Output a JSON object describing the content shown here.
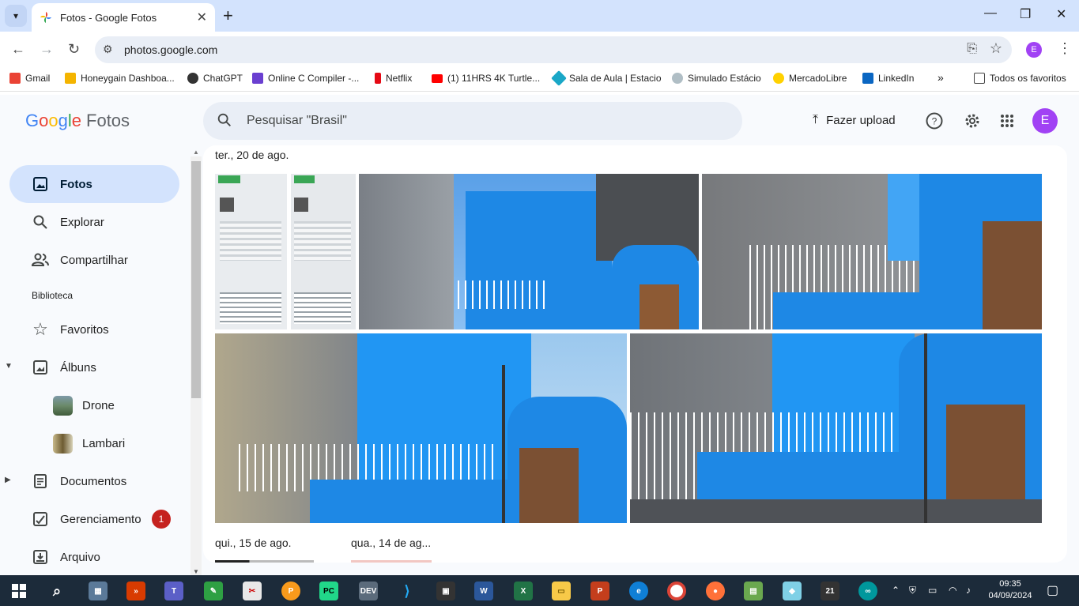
{
  "browser": {
    "tab_title": "Fotos - Google Fotos",
    "url": "photos.google.com",
    "profile_initial": "E",
    "bookmarks": [
      {
        "label": "Gmail",
        "color": "#ea4335"
      },
      {
        "label": "Honeygain Dashboa...",
        "color": "#f4b400"
      },
      {
        "label": "ChatGPT",
        "color": "#333333"
      },
      {
        "label": "Online C Compiler -...",
        "color": "#6a3fd0"
      },
      {
        "label": "Netflix",
        "color": "#e50914"
      },
      {
        "label": "(1) 11HRS 4K Turtle...",
        "color": "#ff0000"
      },
      {
        "label": "Sala de Aula | Estacio",
        "color": "#1aa7c7"
      },
      {
        "label": "Simulado Estácio",
        "color": "#9ab"
      },
      {
        "label": "MercadoLibre",
        "color": "#ffd100"
      },
      {
        "label": "LinkedIn",
        "color": "#0a66c2"
      }
    ],
    "more_bookmarks": "»",
    "all_bookmarks": "Todos os favoritos"
  },
  "app": {
    "logo_google": [
      "G",
      "o",
      "o",
      "g",
      "l",
      "e"
    ],
    "logo_fotos": "Fotos",
    "search_placeholder": "Pesquisar \"Brasil\"",
    "upload_label": "Fazer upload",
    "avatar_initial": "E"
  },
  "sidebar": {
    "items": [
      {
        "label": "Fotos",
        "icon": "photo-icon",
        "active": true
      },
      {
        "label": "Explorar",
        "icon": "search-icon"
      },
      {
        "label": "Compartilhar",
        "icon": "people-icon"
      }
    ],
    "library_label": "Biblioteca",
    "library": [
      {
        "label": "Favoritos",
        "icon": "star-icon"
      },
      {
        "label": "Álbuns",
        "icon": "album-icon",
        "expanded": true
      },
      {
        "label": "Drone",
        "icon": "album-thumb"
      },
      {
        "label": "Lambari",
        "icon": "album-thumb"
      },
      {
        "label": "Documentos",
        "icon": "document-icon",
        "collapsed": true
      },
      {
        "label": "Gerenciamento",
        "icon": "manage-icon",
        "badge": "1"
      },
      {
        "label": "Arquivo",
        "icon": "archive-icon"
      }
    ]
  },
  "timeline": {
    "groups": [
      {
        "date": "ter., 20 de ago."
      },
      {
        "date": "qui., 15 de ago."
      },
      {
        "date": "qua., 14 de ag..."
      }
    ],
    "photo_colors": [
      "#1e88e5",
      "#1976d2",
      "#2196f3"
    ]
  },
  "taskbar": {
    "time": "09:35",
    "date": "04/09/2024"
  }
}
